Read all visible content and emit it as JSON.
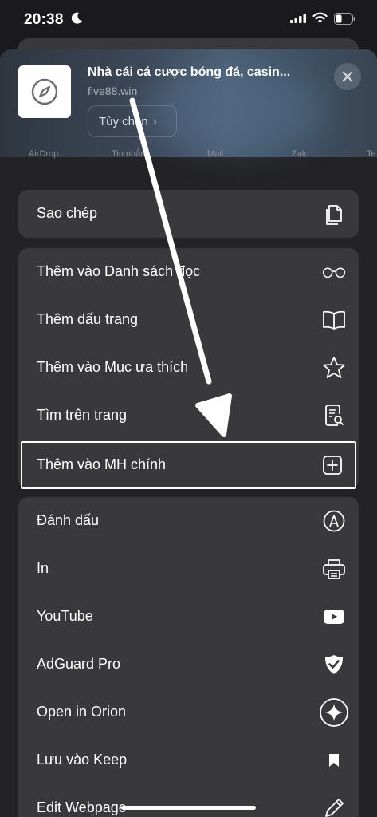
{
  "status_bar": {
    "time": "20:38"
  },
  "header": {
    "site_title": "Nhà cái cá cược bóng đá, casin...",
    "site_url": "five88.win",
    "options_label": "Tùy chọn"
  },
  "share_targets": [
    "AirDrop",
    "Tin nhắn",
    "Mail",
    "Zalo",
    "Te"
  ],
  "actions": {
    "copy": {
      "label": "Sao chép",
      "icon": "copy-icon"
    },
    "group1": [
      {
        "label": "Thêm vào Danh sách đọc",
        "icon": "glasses-icon"
      },
      {
        "label": "Thêm dấu trang",
        "icon": "book-icon"
      },
      {
        "label": "Thêm vào Mục ưa thích",
        "icon": "star-icon"
      },
      {
        "label": "Tìm trên trang",
        "icon": "find-in-page-icon"
      },
      {
        "label": "Thêm vào MH chính",
        "icon": "add-square-icon"
      }
    ],
    "group2": [
      {
        "label": "Đánh dấu",
        "icon": "markup-icon"
      },
      {
        "label": "In",
        "icon": "printer-icon"
      },
      {
        "label": "YouTube",
        "icon": "youtube-icon"
      },
      {
        "label": "AdGuard Pro",
        "icon": "shield-check-icon"
      },
      {
        "label": "Open in Orion",
        "icon": "orion-icon"
      },
      {
        "label": "Lưu vào Keep",
        "icon": "bookmark-icon"
      },
      {
        "label": "Edit Webpage",
        "icon": "pencil-icon"
      }
    ]
  }
}
